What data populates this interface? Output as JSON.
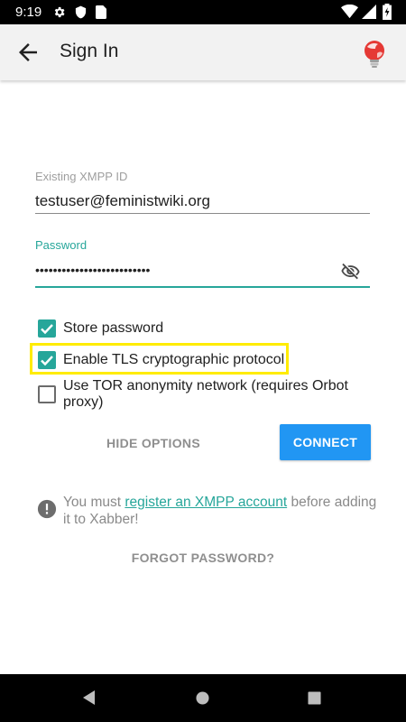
{
  "status_bar": {
    "time": "9:19",
    "icons": [
      "gear-icon",
      "shield-icon",
      "sd-card-icon",
      "wifi-icon",
      "signal-icon",
      "battery-charging-icon"
    ]
  },
  "app_bar": {
    "title": "Sign In",
    "back_icon": "arrow-back-icon",
    "logo_icon": "xabber-lightbulb-logo"
  },
  "form": {
    "xmpp_id": {
      "label": "Existing XMPP ID",
      "value": "testuser@feministwiki.org"
    },
    "password": {
      "label": "Password",
      "value": "••••••••••••••••••••••••••",
      "toggle_icon": "eye-off-icon"
    },
    "options": [
      {
        "label": "Store password",
        "checked": true
      },
      {
        "label": "Enable TLS cryptographic protocol",
        "checked": true
      },
      {
        "label_line1": "Use TOR anonymity network (requires Orbot",
        "label_line2": "proxy)",
        "checked": false
      }
    ]
  },
  "actions": {
    "hide_options": "HIDE OPTIONS",
    "connect": "CONNECT"
  },
  "info": {
    "prefix": "You must ",
    "link": "register an XMPP account",
    "suffix": " before adding it to Xabber!"
  },
  "forgot_password": "FORGOT PASSWORD?",
  "colors": {
    "accent": "#26a69a",
    "primary_button": "#2196f3",
    "highlight": "#ffec00"
  }
}
